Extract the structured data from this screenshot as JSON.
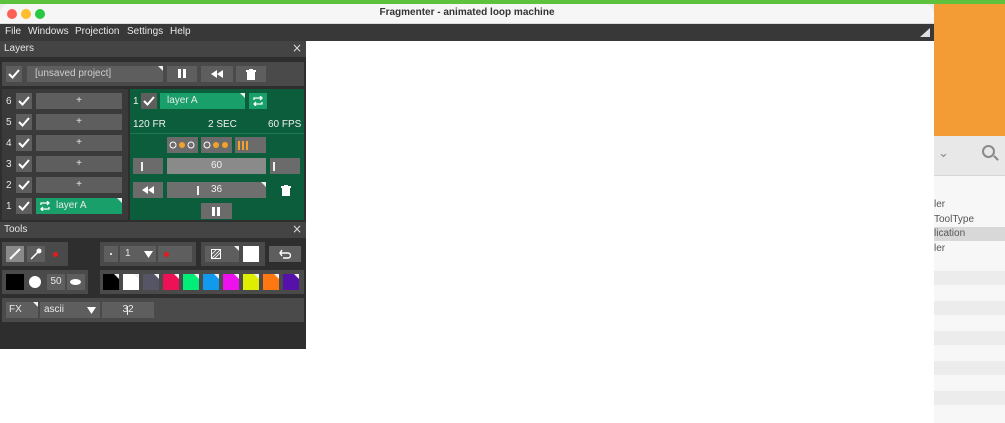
{
  "window": {
    "title": "Fragmenter - animated loop machine"
  },
  "menu": [
    "File",
    "Windows",
    "Projection",
    "Settings",
    "Help"
  ],
  "layers_panel": {
    "title": "Layers",
    "close": "×",
    "project_name": "[unsaved project]",
    "layer_rows": [
      {
        "num": "6",
        "label": "+"
      },
      {
        "num": "5",
        "label": "+"
      },
      {
        "num": "4",
        "label": "+"
      },
      {
        "num": "3",
        "label": "+"
      },
      {
        "num": "2",
        "label": "+"
      },
      {
        "num": "1",
        "label": "layer A"
      }
    ],
    "selected_layer": {
      "num": "1",
      "name": "layer A",
      "frames": "120 FR",
      "seconds": "2 SEC",
      "fps": "60 FPS",
      "slider_value": "60",
      "frame_value": "36"
    }
  },
  "tools_panel": {
    "title": "Tools",
    "close": "×",
    "brush_size": "1",
    "opacity": "50",
    "palette": [
      "#000000",
      "#ffffff",
      "#555566",
      "#ee1155",
      "#00ee77",
      "#1199ee",
      "#ee11ee",
      "#ddee00",
      "#ff7711",
      "#5511aa"
    ],
    "fx_label": "FX",
    "fx_mode": "ascii",
    "fx_value": "32"
  },
  "background_app": {
    "rows": [
      "ler",
      "ToolType",
      "lication",
      "ler"
    ]
  },
  "colors": {
    "accent_green": "#0c5d3c",
    "green_button": "#19a06a",
    "panel_bg": "#2e2e2e"
  }
}
